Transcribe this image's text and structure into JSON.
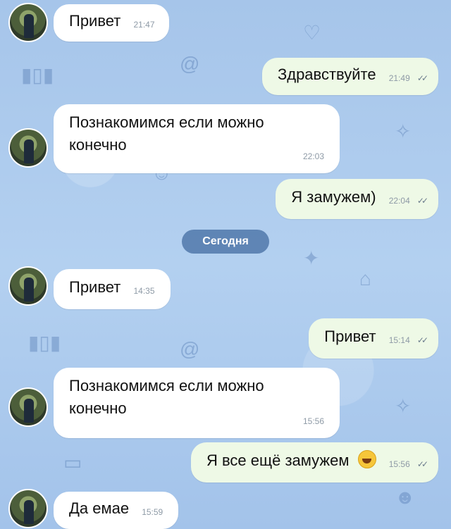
{
  "chat": {
    "date_divider": "Сегодня",
    "messages": [
      {
        "direction": "in",
        "text": "Привет",
        "time": "21:47"
      },
      {
        "direction": "out",
        "text": "Здравствуйте",
        "time": "21:49",
        "read": true
      },
      {
        "direction": "in",
        "text_line1": "Познакомимся если можно",
        "text_line2": "конечно",
        "time": "22:03"
      },
      {
        "direction": "out",
        "text": "Я замужем)",
        "time": "22:04",
        "read": true
      },
      {
        "direction": "in",
        "text": "Привет",
        "time": "14:35"
      },
      {
        "direction": "out",
        "text": "Привет",
        "time": "15:14",
        "read": true
      },
      {
        "direction": "in",
        "text_line1": "Познакомимся если можно",
        "text_line2": "конечно",
        "time": "15:56"
      },
      {
        "direction": "out",
        "text": "Я все ещё замужем",
        "emoji": "grinning-face",
        "time": "15:56",
        "read": true
      },
      {
        "direction": "in",
        "text": "Да емае",
        "time": "15:59"
      }
    ]
  },
  "colors": {
    "incoming_bubble": "#ffffff",
    "outgoing_bubble": "#eef9e6",
    "background": "#a9c8ec",
    "date_pill": "#5078aa"
  },
  "icons": {
    "read_receipt": "double-check-icon",
    "avatar": "user-avatar"
  }
}
